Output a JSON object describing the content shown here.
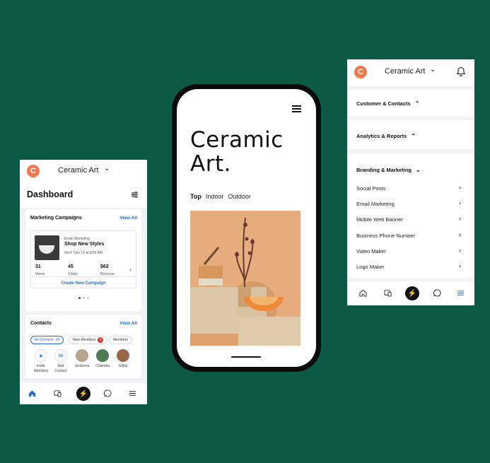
{
  "left": {
    "app_title": "Ceramic Art",
    "logo_letter": "C",
    "page_title": "Dashboard",
    "campaigns": {
      "title": "Marketing Campaigns",
      "view_all": "View All",
      "email_type": "Email Marketing",
      "email_title": "Shop New Styles",
      "sent": "Sent: Dec 12 at 9:55 AM",
      "stats": [
        {
          "value": "31",
          "label": "Views"
        },
        {
          "value": "45",
          "label": "Clicks"
        },
        {
          "value": "$62",
          "label": "Revenue"
        }
      ],
      "create_button": "Create New Campaign"
    },
    "contacts": {
      "title": "Contacts",
      "view_all": "View All",
      "chips": {
        "all": "All Contacts",
        "all_count": "24",
        "new": "New Members",
        "new_count": "2",
        "members": "Members"
      },
      "people": [
        {
          "line1": "Invite",
          "line2": "Members"
        },
        {
          "line1": "Add",
          "line2": "Contact"
        },
        {
          "line1": "Jordanna",
          "line2": ""
        },
        {
          "line1": "Chakrika",
          "line2": ""
        },
        {
          "line1": "Gibby",
          "line2": ""
        }
      ]
    }
  },
  "phone": {
    "title_line1": "Ceramic",
    "title_line2": "Art.",
    "tabs": [
      "Top",
      "Indoor",
      "Outdoor"
    ]
  },
  "right": {
    "app_title": "Ceramic Art",
    "logo_letter": "C",
    "sections": {
      "customers": "Customer & Contacts",
      "analytics": "Analytics & Reports",
      "branding": "Branding & Marketing"
    },
    "items": [
      "Social Posts",
      "Email Marketing",
      "Mobile Web Banner",
      "Business Phone Number",
      "Video Maker",
      "Logo Maker"
    ]
  },
  "colors": {
    "background": "#0c5a46",
    "brand": "#f07a4b",
    "link": "#1f6dd6",
    "badge": "#e0352b"
  },
  "icons": [
    "filter-icon",
    "home-icon",
    "devices-icon",
    "bolt-icon",
    "chat-icon",
    "menu-icon",
    "bell-icon",
    "chevron-right-icon",
    "send-icon",
    "mail-plus-icon"
  ]
}
